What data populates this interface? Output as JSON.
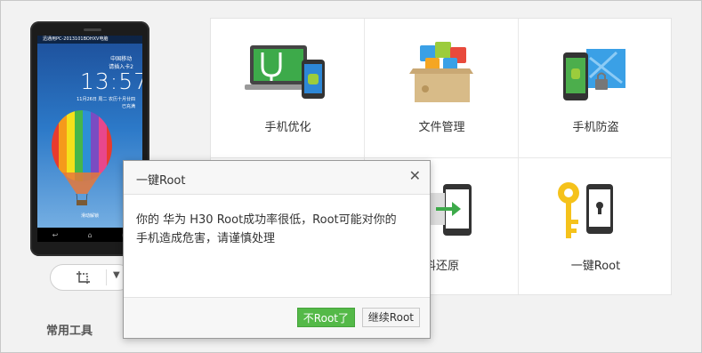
{
  "phone": {
    "statusbar_text": "迅通用PC-2013101BOHXV电脑",
    "carrier_line1": "中国移动",
    "carrier_line2": "请插入卡2",
    "clock": "13:57",
    "date_line1": "11月26日 周二   农历十月廿四",
    "date_line2": "已充满",
    "unlock_text": "滑动解锁"
  },
  "screenshot_control": {
    "crop_icon": "screenshot-crop-icon",
    "menu_icon": "chevron-down-icon"
  },
  "sidebar": {
    "section_title": "常用工具"
  },
  "tools": [
    {
      "label": "手机优化",
      "icon": "phone-optimize-icon"
    },
    {
      "label": "文件管理",
      "icon": "file-manager-icon"
    },
    {
      "label": "手机防盗",
      "icon": "anti-theft-icon"
    },
    {
      "label": "",
      "icon": ""
    },
    {
      "label": "料还原",
      "icon": "data-restore-icon"
    },
    {
      "label": "一键Root",
      "icon": "one-key-root-icon"
    }
  ],
  "dialog": {
    "title": "一键Root",
    "close_icon": "close-icon",
    "message_line1": "你的 华为 H30 Root成功率很低，Root可能对你的",
    "message_line2": "手机造成危害，请谨慎处理",
    "primary_button": "不Root了",
    "secondary_button": "继续Root"
  },
  "colors": {
    "accent_green": "#54b948",
    "background": "#f2f2f2"
  }
}
